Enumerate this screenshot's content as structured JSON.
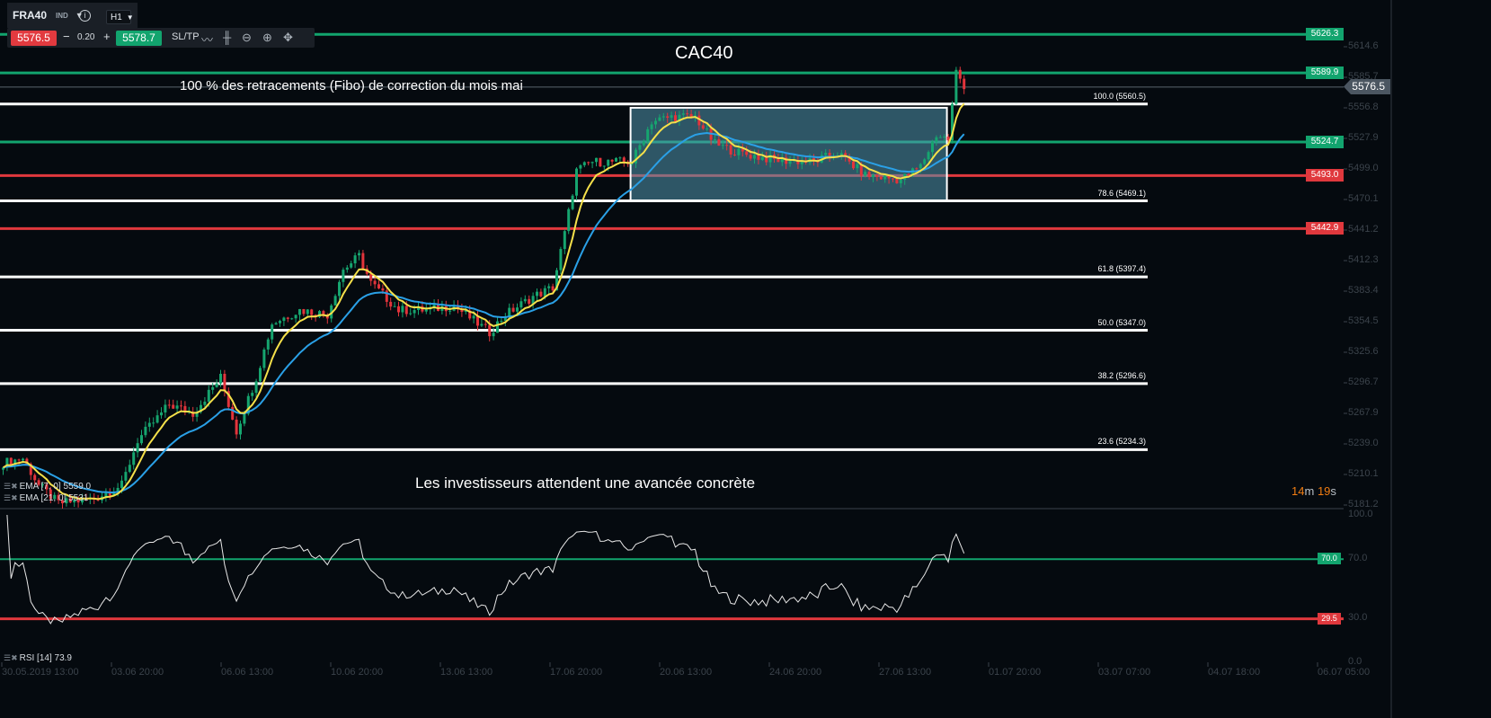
{
  "instrument": {
    "symbol": "FRA40",
    "type": "IND",
    "timeframe": "H1"
  },
  "trade": {
    "bid": "5576.5",
    "ask": "5578.7",
    "spread": "0.20",
    "minus": "−",
    "plus": "+",
    "sltp": "SL/TP"
  },
  "toolbar_icons": [
    "line-chart-icon",
    "candles-icon",
    "zoom-out-icon",
    "zoom-in-icon",
    "move-icon"
  ],
  "annotations": {
    "title": "CAC40",
    "fibo_note": "100 % des retracements (Fibo) de correction du mois mai",
    "headline": "Les investisseurs attendent une avancée concrète"
  },
  "legend": {
    "ema7": "EMA [7, 0] 5559.0",
    "ema21": "EMA [21, 0] 5531",
    "rsi": "RSI [14] 73.9"
  },
  "timer": {
    "min": "14",
    "min_unit": "m",
    "sec": "19",
    "sec_unit": "s"
  },
  "colors": {
    "up": "#16a56f",
    "down": "#e3343b",
    "ema7": "#f5e04a",
    "ema21": "#2aa0e6",
    "green_line": "#12a46e",
    "red_line": "#e0383d"
  },
  "chart_data": {
    "type": "candlestick",
    "title": "CAC40",
    "ylim": [
      5181.2,
      5614.6
    ],
    "y_ticks": [
      "5614.6",
      "5585.7",
      "5556.8",
      "5527.9",
      "5499.0",
      "5470.1",
      "5441.2",
      "5412.3",
      "5383.4",
      "5354.5",
      "5325.6",
      "5296.7",
      "5267.9",
      "5239.0",
      "5210.1",
      "5181.2"
    ],
    "x_ticks": [
      "30.05.2019 13:00",
      "03.06 20:00",
      "06.06 13:00",
      "10.06 20:00",
      "13.06 13:00",
      "17.06 20:00",
      "20.06 13:00",
      "24.06 20:00",
      "27.06 13:00",
      "01.07 20:00",
      "03.07 07:00",
      "04.07 18:00",
      "06.07 05:00"
    ],
    "bars_per_tick": 27.7,
    "current_price": "5576.5",
    "close_keypoints": [
      [
        0,
        5221.9
      ],
      [
        5,
        5226.1
      ],
      [
        9,
        5200.7
      ],
      [
        14,
        5183.7
      ],
      [
        23,
        5188.0
      ],
      [
        30,
        5200.7
      ],
      [
        34,
        5243.1
      ],
      [
        42,
        5277.0
      ],
      [
        48,
        5268.5
      ],
      [
        55,
        5302.5
      ],
      [
        59,
        5251.6
      ],
      [
        64,
        5302.5
      ],
      [
        68,
        5353.4
      ],
      [
        75,
        5366.1
      ],
      [
        82,
        5361.8
      ],
      [
        86,
        5404.3
      ],
      [
        90,
        5417.0
      ],
      [
        93,
        5391.5
      ],
      [
        100,
        5366.1
      ],
      [
        107,
        5366.1
      ],
      [
        114,
        5370.3
      ],
      [
        123,
        5344.9
      ],
      [
        127,
        5361.8
      ],
      [
        134,
        5378.8
      ],
      [
        139,
        5387.3
      ],
      [
        142,
        5438.2
      ],
      [
        145,
        5497.6
      ],
      [
        149,
        5506.0
      ],
      [
        159,
        5506.0
      ],
      [
        164,
        5544.2
      ],
      [
        169,
        5548.4
      ],
      [
        175,
        5548.4
      ],
      [
        180,
        5523.0
      ],
      [
        186,
        5514.5
      ],
      [
        195,
        5507.7
      ],
      [
        205,
        5506.0
      ],
      [
        211,
        5514.5
      ],
      [
        218,
        5493.3
      ],
      [
        227,
        5489.1
      ],
      [
        232,
        5501.8
      ],
      [
        236,
        5531.5
      ],
      [
        239,
        5527.2
      ],
      [
        241,
        5590.9
      ],
      [
        243,
        5578.1
      ]
    ],
    "horizontal_levels": [
      {
        "value": 5626.3,
        "label": "5626.3",
        "kind": "green"
      },
      {
        "value": 5589.9,
        "label": "5589.9",
        "kind": "green"
      },
      {
        "value": 5524.7,
        "label": "5524.7",
        "kind": "green"
      },
      {
        "value": 5493.0,
        "label": "5493.0",
        "kind": "red"
      },
      {
        "value": 5442.9,
        "label": "5442.9",
        "kind": "red"
      }
    ],
    "fibonacci": [
      {
        "value": 5560.5,
        "label": "100.0 (5560.5)"
      },
      {
        "value": 5469.1,
        "label": "78.6 (5469.1)"
      },
      {
        "value": 5397.4,
        "label": "61.8 (5397.4)"
      },
      {
        "value": 5347.0,
        "label": "50.0 (5347.0)"
      },
      {
        "value": 5296.6,
        "label": "38.2 (5296.6)"
      },
      {
        "value": 5234.3,
        "label": "23.6 (5234.3)"
      }
    ],
    "range_box": {
      "bar_from": 159,
      "bar_to": 239,
      "price_high": 5557,
      "price_low": 5469.1
    },
    "rsi": {
      "period": 14,
      "last": 73.9,
      "ylim": [
        0,
        100
      ],
      "y_ticks": [
        "100.0",
        "70.0",
        "30.0",
        "0.0"
      ],
      "overbought": {
        "value": 70,
        "label": "70.0"
      },
      "oversold": {
        "value": 29.5,
        "label": "29.5"
      }
    }
  }
}
